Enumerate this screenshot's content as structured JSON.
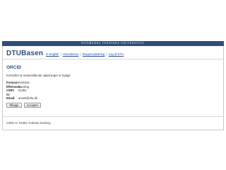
{
  "top_bar": {
    "text": "DANMARKS TEKNISKE UNIVERSITET"
  },
  "header": {
    "logo": "DTUBasen",
    "nav": [
      {
        "label": "In English"
      },
      {
        "label": "Hovedmenu"
      },
      {
        "label": "Brugervejledning"
      },
      {
        "label": "Log af DTU"
      }
    ],
    "separator": "|"
  },
  "page": {
    "title": "ORCID",
    "instruction": "Kontroller at nedenstående oplysninger er rigtige:",
    "fields": [
      {
        "label": "Fornavn:",
        "value": "Andreas"
      },
      {
        "label": "Efternavn:",
        "value": "Nussing"
      },
      {
        "label": "CWIS nr:",
        "value": "51381"
      },
      {
        "label": "Email:",
        "value": "anuss@dtu.dk"
      }
    ],
    "buttons": {
      "back": "Tilbage",
      "accept": "Accepter"
    }
  },
  "footer": {
    "text": "CWIS nr: 51381 Andreas Nussing"
  },
  "colors": {
    "brand": "#2f4f77",
    "link": "#2a4f9a"
  }
}
